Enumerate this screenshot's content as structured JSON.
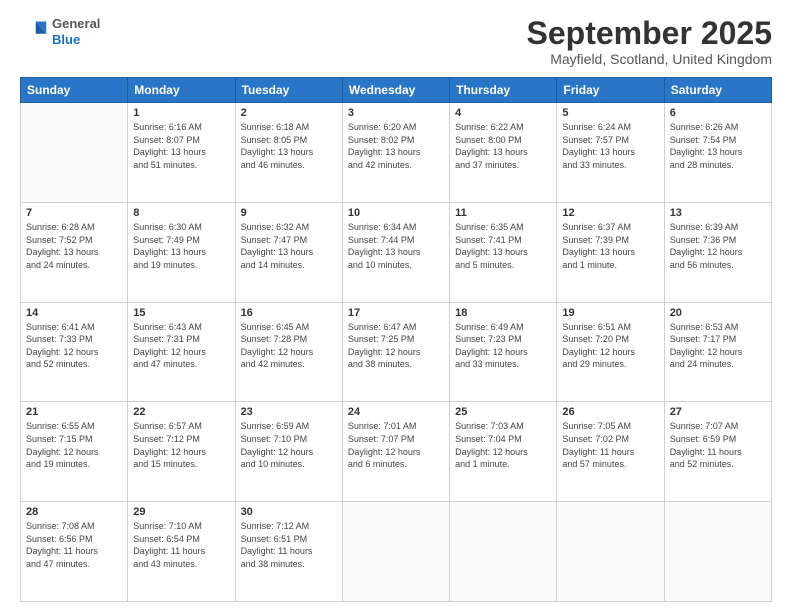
{
  "logo": {
    "general": "General",
    "blue": "Blue"
  },
  "header": {
    "month": "September 2025",
    "location": "Mayfield, Scotland, United Kingdom"
  },
  "weekdays": [
    "Sunday",
    "Monday",
    "Tuesday",
    "Wednesday",
    "Thursday",
    "Friday",
    "Saturday"
  ],
  "weeks": [
    [
      {
        "day": "",
        "content": ""
      },
      {
        "day": "1",
        "content": "Sunrise: 6:16 AM\nSunset: 8:07 PM\nDaylight: 13 hours\nand 51 minutes."
      },
      {
        "day": "2",
        "content": "Sunrise: 6:18 AM\nSunset: 8:05 PM\nDaylight: 13 hours\nand 46 minutes."
      },
      {
        "day": "3",
        "content": "Sunrise: 6:20 AM\nSunset: 8:02 PM\nDaylight: 13 hours\nand 42 minutes."
      },
      {
        "day": "4",
        "content": "Sunrise: 6:22 AM\nSunset: 8:00 PM\nDaylight: 13 hours\nand 37 minutes."
      },
      {
        "day": "5",
        "content": "Sunrise: 6:24 AM\nSunset: 7:57 PM\nDaylight: 13 hours\nand 33 minutes."
      },
      {
        "day": "6",
        "content": "Sunrise: 6:26 AM\nSunset: 7:54 PM\nDaylight: 13 hours\nand 28 minutes."
      }
    ],
    [
      {
        "day": "7",
        "content": "Sunrise: 6:28 AM\nSunset: 7:52 PM\nDaylight: 13 hours\nand 24 minutes."
      },
      {
        "day": "8",
        "content": "Sunrise: 6:30 AM\nSunset: 7:49 PM\nDaylight: 13 hours\nand 19 minutes."
      },
      {
        "day": "9",
        "content": "Sunrise: 6:32 AM\nSunset: 7:47 PM\nDaylight: 13 hours\nand 14 minutes."
      },
      {
        "day": "10",
        "content": "Sunrise: 6:34 AM\nSunset: 7:44 PM\nDaylight: 13 hours\nand 10 minutes."
      },
      {
        "day": "11",
        "content": "Sunrise: 6:35 AM\nSunset: 7:41 PM\nDaylight: 13 hours\nand 5 minutes."
      },
      {
        "day": "12",
        "content": "Sunrise: 6:37 AM\nSunset: 7:39 PM\nDaylight: 13 hours\nand 1 minute."
      },
      {
        "day": "13",
        "content": "Sunrise: 6:39 AM\nSunset: 7:36 PM\nDaylight: 12 hours\nand 56 minutes."
      }
    ],
    [
      {
        "day": "14",
        "content": "Sunrise: 6:41 AM\nSunset: 7:33 PM\nDaylight: 12 hours\nand 52 minutes."
      },
      {
        "day": "15",
        "content": "Sunrise: 6:43 AM\nSunset: 7:31 PM\nDaylight: 12 hours\nand 47 minutes."
      },
      {
        "day": "16",
        "content": "Sunrise: 6:45 AM\nSunset: 7:28 PM\nDaylight: 12 hours\nand 42 minutes."
      },
      {
        "day": "17",
        "content": "Sunrise: 6:47 AM\nSunset: 7:25 PM\nDaylight: 12 hours\nand 38 minutes."
      },
      {
        "day": "18",
        "content": "Sunrise: 6:49 AM\nSunset: 7:23 PM\nDaylight: 12 hours\nand 33 minutes."
      },
      {
        "day": "19",
        "content": "Sunrise: 6:51 AM\nSunset: 7:20 PM\nDaylight: 12 hours\nand 29 minutes."
      },
      {
        "day": "20",
        "content": "Sunrise: 6:53 AM\nSunset: 7:17 PM\nDaylight: 12 hours\nand 24 minutes."
      }
    ],
    [
      {
        "day": "21",
        "content": "Sunrise: 6:55 AM\nSunset: 7:15 PM\nDaylight: 12 hours\nand 19 minutes."
      },
      {
        "day": "22",
        "content": "Sunrise: 6:57 AM\nSunset: 7:12 PM\nDaylight: 12 hours\nand 15 minutes."
      },
      {
        "day": "23",
        "content": "Sunrise: 6:59 AM\nSunset: 7:10 PM\nDaylight: 12 hours\nand 10 minutes."
      },
      {
        "day": "24",
        "content": "Sunrise: 7:01 AM\nSunset: 7:07 PM\nDaylight: 12 hours\nand 6 minutes."
      },
      {
        "day": "25",
        "content": "Sunrise: 7:03 AM\nSunset: 7:04 PM\nDaylight: 12 hours\nand 1 minute."
      },
      {
        "day": "26",
        "content": "Sunrise: 7:05 AM\nSunset: 7:02 PM\nDaylight: 11 hours\nand 57 minutes."
      },
      {
        "day": "27",
        "content": "Sunrise: 7:07 AM\nSunset: 6:59 PM\nDaylight: 11 hours\nand 52 minutes."
      }
    ],
    [
      {
        "day": "28",
        "content": "Sunrise: 7:08 AM\nSunset: 6:56 PM\nDaylight: 11 hours\nand 47 minutes."
      },
      {
        "day": "29",
        "content": "Sunrise: 7:10 AM\nSunset: 6:54 PM\nDaylight: 11 hours\nand 43 minutes."
      },
      {
        "day": "30",
        "content": "Sunrise: 7:12 AM\nSunset: 6:51 PM\nDaylight: 11 hours\nand 38 minutes."
      },
      {
        "day": "",
        "content": ""
      },
      {
        "day": "",
        "content": ""
      },
      {
        "day": "",
        "content": ""
      },
      {
        "day": "",
        "content": ""
      }
    ]
  ]
}
